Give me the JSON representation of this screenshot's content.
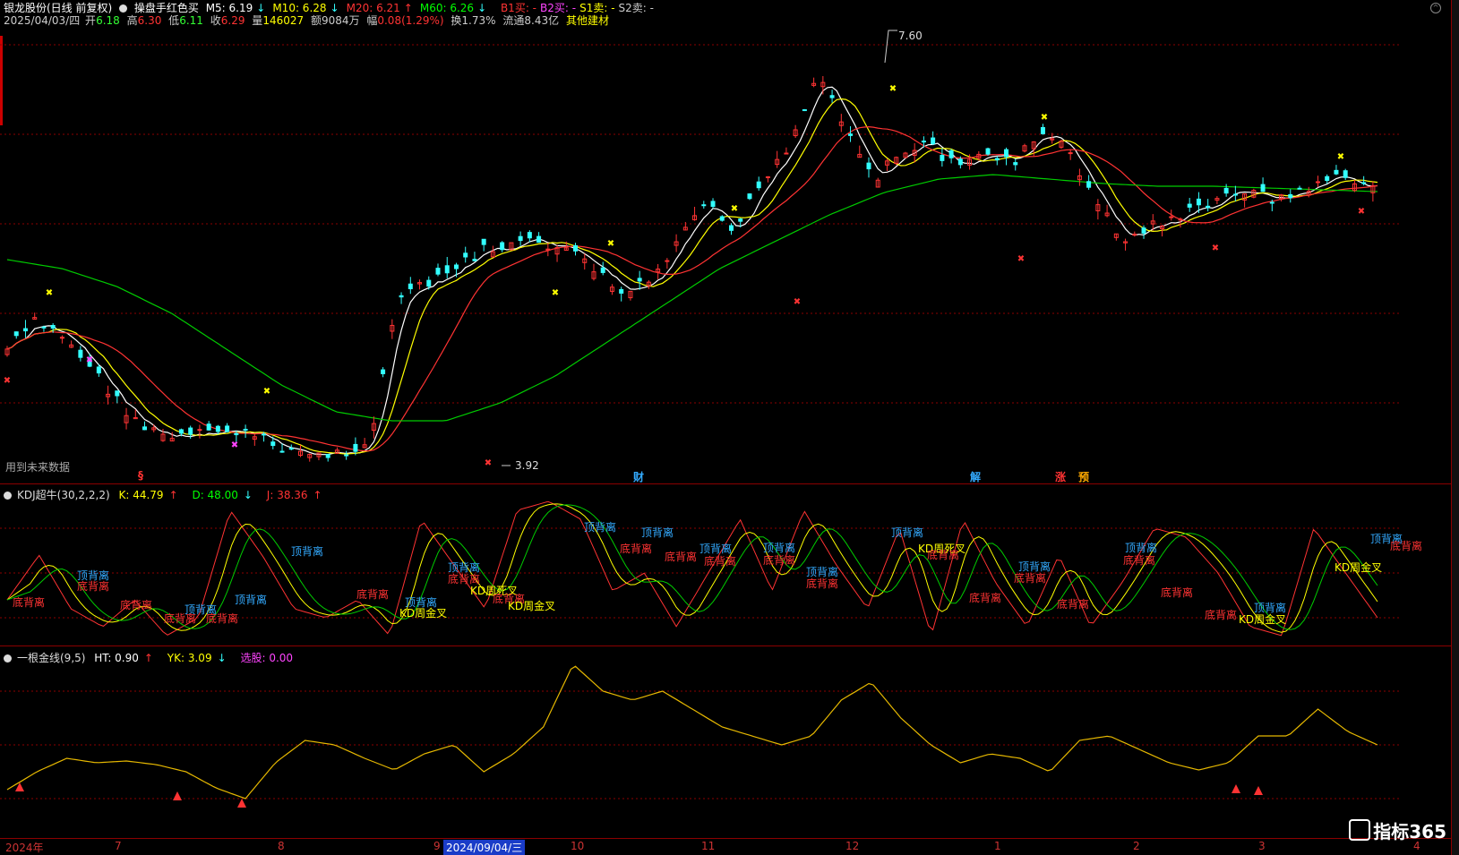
{
  "header": {
    "stock_name": "银龙股份(日线 前复权)",
    "indicator": "操盘手红色买",
    "ma": [
      {
        "label": "M5: 6.19",
        "arrow": "↓",
        "color": "#ffffff"
      },
      {
        "label": "M10: 6.28",
        "arrow": "↓",
        "color": "#ffff00"
      },
      {
        "label": "M20: 6.21",
        "arrow": "↑",
        "color": "#ff3333"
      },
      {
        "label": "M60: 6.26",
        "arrow": "↓",
        "color": "#00ff00"
      }
    ],
    "signals": [
      {
        "label": "B1买: -",
        "color": "#ff3333"
      },
      {
        "label": "B2买: -",
        "color": "#ff44ff"
      },
      {
        "label": "S1卖: -",
        "color": "#ffff00"
      },
      {
        "label": "S2卖: -",
        "color": "#cccccc"
      }
    ],
    "quote": {
      "date": "2025/04/03/四",
      "open_label": "开",
      "open": "6.18",
      "high_label": "高",
      "high": "6.30",
      "low_label": "低",
      "low": "6.11",
      "close_label": "收",
      "close": "6.29",
      "vol_label": "量",
      "vol": "146027",
      "amt_label": "额",
      "amt": "9084万",
      "chg_label": "幅",
      "chg": "0.08(1.29%)",
      "turn_label": "换",
      "turn": "1.73%",
      "float_label": "流通",
      "float": "8.43亿",
      "sector": "其他建材"
    }
  },
  "main_chart": {
    "high_label": "7.60",
    "low_label": "3.92",
    "future_note": "用到未来数据",
    "event_markers": [
      {
        "text": "§",
        "color": "#ff3333"
      },
      {
        "text": "财",
        "color": "#33aaff"
      },
      {
        "text": "解",
        "color": "#33aaff"
      },
      {
        "text": "涨",
        "color": "#ff3333"
      },
      {
        "text": "预",
        "color": "#ffaa00"
      }
    ]
  },
  "kdj_panel": {
    "title": "KDJ超牛(30,2,2,2)",
    "k": {
      "label": "K: 44.79",
      "arrow": "↑",
      "color": "#ffff00"
    },
    "d": {
      "label": "D: 48.00",
      "arrow": "↓",
      "color": "#00ff00"
    },
    "j": {
      "label": "J: 38.36",
      "arrow": "↑",
      "color": "#ff3333"
    },
    "labels": {
      "top": "顶背离",
      "bottom": "底背离",
      "golden": "KD周金叉",
      "death": "KD周死叉"
    }
  },
  "gold_panel": {
    "title": "一根金线(9,5)",
    "ht": {
      "label": "HT: 0.90",
      "arrow": "↑",
      "color": "#ffffff"
    },
    "yk": {
      "label": "YK: 3.09",
      "arrow": "↓",
      "color": "#ffff00"
    },
    "xg": {
      "label": "选股: 0.00",
      "color": "#ff44ff"
    }
  },
  "xaxis": {
    "labels": [
      "2024年",
      "7",
      "8",
      "9",
      "10",
      "11",
      "12",
      "1",
      "2",
      "3",
      "4"
    ],
    "cursor_date": "2024/09/04/三"
  },
  "logo": "指标365",
  "colors": {
    "up": "#ff3333",
    "down": "#33ffff",
    "ma5": "#ffffff",
    "ma10": "#ffff00",
    "ma20": "#ff3333",
    "ma60": "#00ff00"
  },
  "chart_data": {
    "type": "line",
    "series": [
      {
        "name": "M5",
        "values": []
      },
      {
        "name": "M10",
        "values": []
      }
    ]
  }
}
